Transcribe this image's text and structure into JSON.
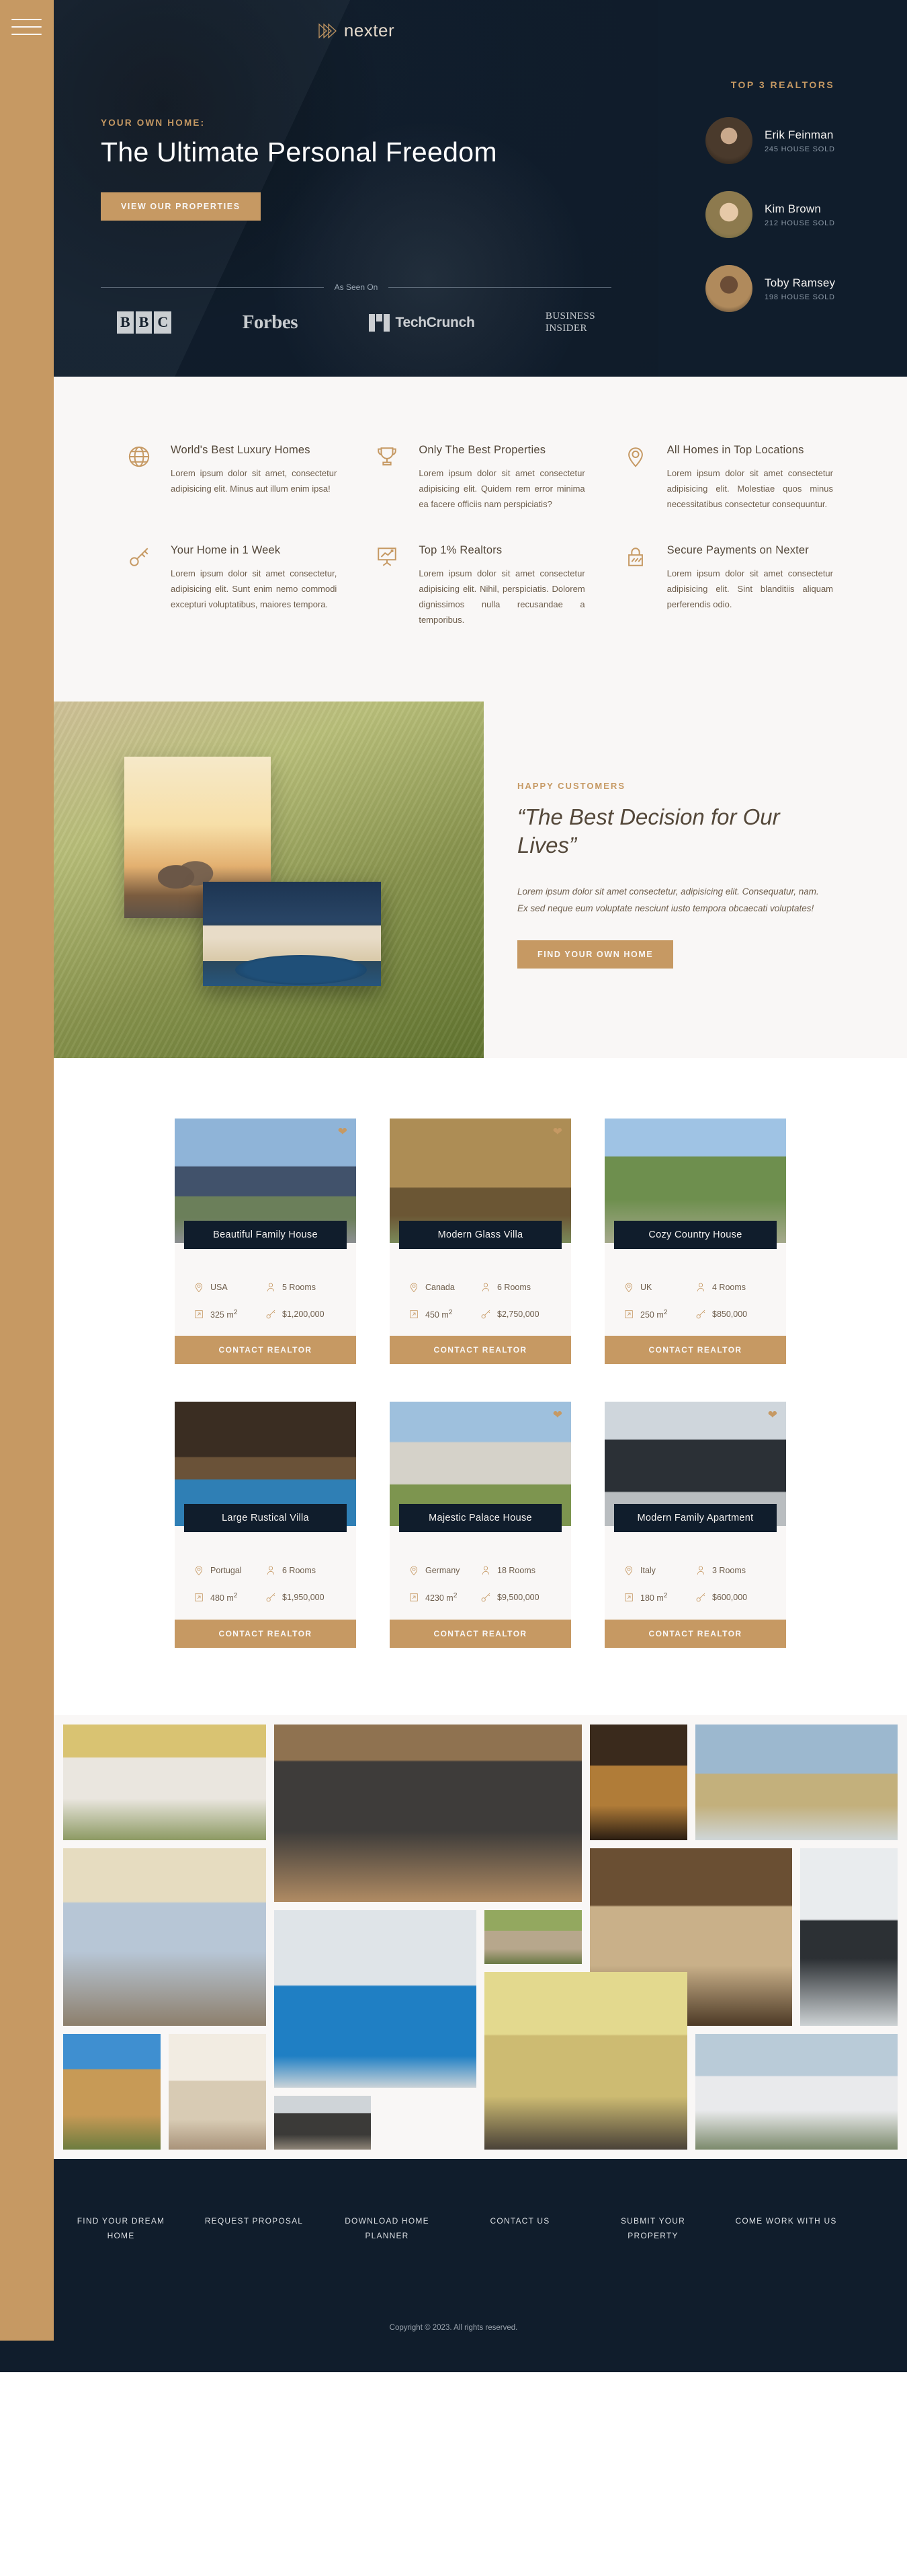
{
  "brand": {
    "name": "nexter",
    "logo_icon": "triple-chevron-logo"
  },
  "nav": {
    "menu_icon": "hamburger-menu-icon"
  },
  "hero": {
    "eyebrow": "YOUR OWN HOME:",
    "title": "The Ultimate Personal Freedom",
    "cta": "VIEW OUR PROPERTIES"
  },
  "seen_on": {
    "label": "As Seen On",
    "logos": [
      {
        "name": "BBC",
        "letters": [
          "B",
          "B",
          "C"
        ]
      },
      {
        "name": "Forbes"
      },
      {
        "name": "TechCrunch"
      },
      {
        "name": "Business Insider",
        "line1": "Business",
        "line2": "Insider"
      }
    ]
  },
  "realtors": {
    "heading": "TOP 3 REALTORS",
    "items": [
      {
        "name": "Erik Feinman",
        "sold": "245 HOUSE SOLD"
      },
      {
        "name": "Kim Brown",
        "sold": "212 HOUSE SOLD"
      },
      {
        "name": "Toby Ramsey",
        "sold": "198 HOUSE SOLD"
      }
    ]
  },
  "features": [
    {
      "icon": "globe-icon",
      "title": "World's Best Luxury Homes",
      "text": "Lorem ipsum dolor sit amet, consectetur adipisicing elit. Minus aut illum enim ipsa!"
    },
    {
      "icon": "trophy-icon",
      "title": "Only The Best Properties",
      "text": "Lorem ipsum dolor sit amet consectetur adipisicing elit. Quidem rem error minima ea facere officiis nam perspiciatis?"
    },
    {
      "icon": "map-pin-icon",
      "title": "All Homes in Top Locations",
      "text": "Lorem ipsum dolor sit amet consectetur adipisicing elit. Molestiae quos minus necessitatibus consectetur consequuntur."
    },
    {
      "icon": "key-icon",
      "title": "Your Home in 1 Week",
      "text": "Lorem ipsum dolor sit amet consectetur, adipisicing elit. Sunt enim nemo commodi excepturi voluptatibus, maiores tempora."
    },
    {
      "icon": "presentation-chart-icon",
      "title": "Top 1% Realtors",
      "text": "Lorem ipsum dolor sit amet consectetur adipisicing elit. Nihil, perspiciatis. Dolorem dignissimos nulla recusandae a temporibus."
    },
    {
      "icon": "lock-icon",
      "title": "Secure Payments on Nexter",
      "text": "Lorem ipsum dolor sit amet consectetur adipisicing elit. Sint blanditiis aliquam perferendis odio."
    }
  ],
  "story": {
    "eyebrow": "HAPPY CUSTOMERS",
    "title": "“The Best Decision for Our Lives”",
    "text": "Lorem ipsum dolor sit amet consectetur, adipisicing elit. Consequatur, nam. Ex sed neque eum voluptate nesciunt iusto tempora obcaecati voluptates!",
    "cta": "FIND YOUR OWN HOME",
    "images": [
      "couple-sunset-photo",
      "villa-pool-night-photo"
    ]
  },
  "homes": {
    "cta_label": "CONTACT REALTOR",
    "items": [
      {
        "name": "Beautiful Family House",
        "country": "USA",
        "rooms": "5 Rooms",
        "area": "325 m",
        "area_sup": "2",
        "price": "$1,200,000",
        "liked": true
      },
      {
        "name": "Modern Glass Villa",
        "country": "Canada",
        "rooms": "6 Rooms",
        "area": "450 m",
        "area_sup": "2",
        "price": "$2,750,000",
        "liked": true
      },
      {
        "name": "Cozy Country House",
        "country": "UK",
        "rooms": "4 Rooms",
        "area": "250 m",
        "area_sup": "2",
        "price": "$850,000",
        "liked": false
      },
      {
        "name": "Large Rustical Villa",
        "country": "Portugal",
        "rooms": "6 Rooms",
        "area": "480 m",
        "area_sup": "2",
        "price": "$1,950,000",
        "liked": false
      },
      {
        "name": "Majestic Palace House",
        "country": "Germany",
        "rooms": "18 Rooms",
        "area": "4230 m",
        "area_sup": "2",
        "price": "$9,500,000",
        "liked": true
      },
      {
        "name": "Modern Family Apartment",
        "country": "Italy",
        "rooms": "3 Rooms",
        "area": "180 m",
        "area_sup": "2",
        "price": "$600,000",
        "liked": true
      }
    ]
  },
  "gallery": {
    "count": 14
  },
  "footer": {
    "links": [
      "Find your dream home",
      "Request proposal",
      "Download home planner",
      "Contact us",
      "Submit your property",
      "Come work with us"
    ],
    "copyright": "Copyright © 2023. All rights reserved."
  },
  "colors": {
    "gold": "#c69963",
    "navy": "#101d2c",
    "light": "#f9f7f6",
    "text": "#54483A"
  }
}
